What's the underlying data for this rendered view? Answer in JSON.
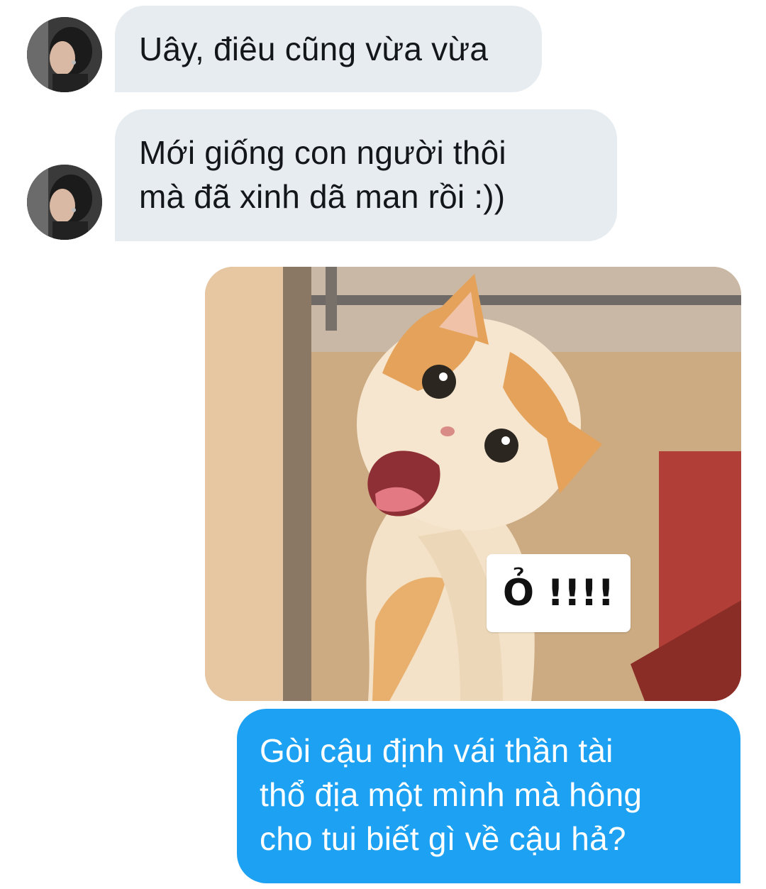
{
  "conversation": {
    "incoming": [
      {
        "lines": [
          "Uây, điêu cũng vừa vừa"
        ]
      },
      {
        "lines": [
          "Mới giống con người thôi",
          "mà đã xinh dã man rồi :))"
        ]
      }
    ],
    "outgoing": {
      "media": {
        "caption": "Ỏ !!!!"
      },
      "lines": [
        "Gòi cậu định vái thần tài",
        "thổ địa một mình mà hông",
        "cho tui biết gì về cậu hả?"
      ]
    }
  },
  "colors": {
    "incoming_bubble": "#e6ecf0",
    "outgoing_bubble": "#1da1f2",
    "incoming_text": "#14171a",
    "outgoing_text": "#ffffff"
  }
}
